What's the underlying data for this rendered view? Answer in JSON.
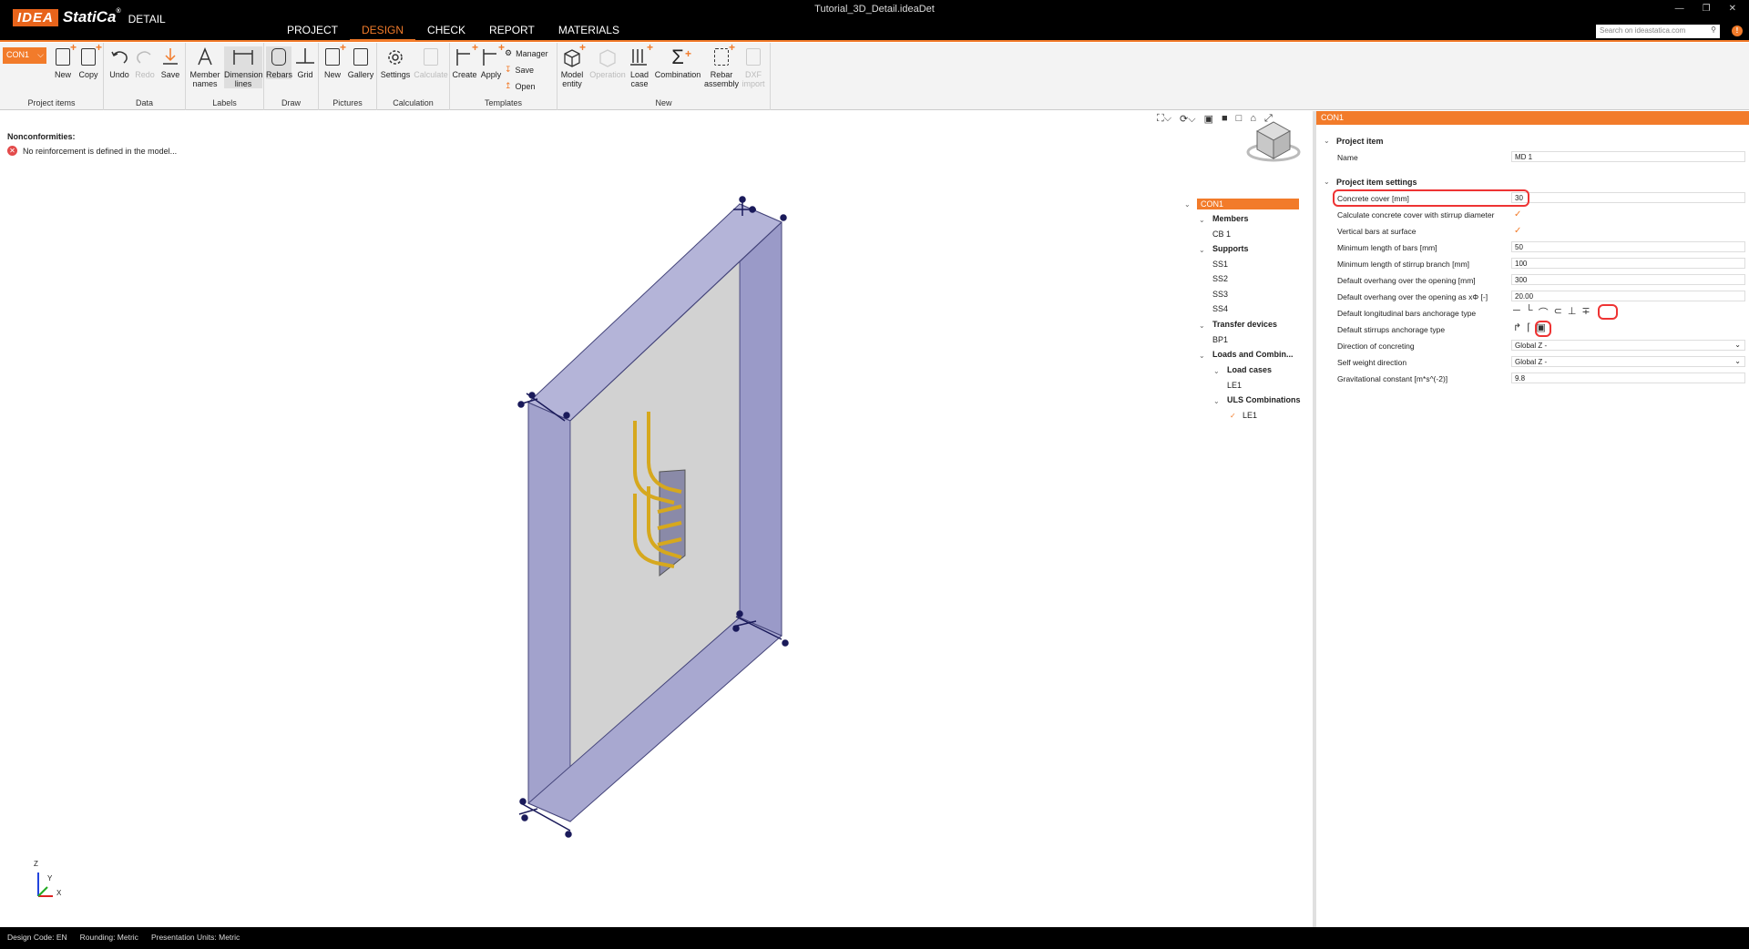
{
  "app": {
    "file_title": "Tutorial_3D_Detail.ideaDet",
    "logo_a": "IDEA",
    "logo_b": "StatiCa",
    "logo_reg": "®",
    "logo_c": "DETAIL"
  },
  "menu": [
    "PROJECT",
    "DESIGN",
    "CHECK",
    "REPORT",
    "MATERIALS"
  ],
  "search": {
    "placeholder": "Search on ideastatica.com"
  },
  "ribbon": {
    "con_select": "CON1",
    "groups": {
      "project_items": "Project items",
      "data": "Data",
      "labels": "Labels",
      "draw": "Draw",
      "pictures": "Pictures",
      "calculation": "Calculation",
      "templates": "Templates",
      "new": "New"
    },
    "buttons": {
      "new": "New",
      "copy": "Copy",
      "undo": "Undo",
      "redo": "Redo",
      "save": "Save",
      "member_names_1": "Member",
      "member_names_2": "names",
      "dimension_lines_1": "Dimension",
      "dimension_lines_2": "lines",
      "rebars": "Rebars",
      "grid": "Grid",
      "pic_new": "New",
      "gallery": "Gallery",
      "settings": "Settings",
      "calculate": "Calculate",
      "create": "Create",
      "apply": "Apply",
      "manager": "Manager",
      "tpl_save": "Save",
      "open": "Open",
      "model_entity_1": "Model",
      "model_entity_2": "entity",
      "operation": "Operation",
      "load_case_1": "Load",
      "load_case_2": "case",
      "combination": "Combination",
      "rebar_assembly_1": "Rebar",
      "rebar_assembly_2": "assembly",
      "dxf_import_1": "DXF",
      "dxf_import_2": "import"
    }
  },
  "nonconformities": {
    "title": "Nonconformities:",
    "message": "No reinforcement is defined in the model..."
  },
  "tree": {
    "root": "CON1",
    "members": "Members",
    "cb1": "CB 1",
    "supports": "Supports",
    "ss1": "SS1",
    "ss2": "SS2",
    "ss3": "SS3",
    "ss4": "SS4",
    "transfer": "Transfer devices",
    "bp1": "BP1",
    "loads": "Loads and Combin...",
    "load_cases": "Load cases",
    "le1": "LE1",
    "uls": "ULS Combinations",
    "le1_uls": "LE1"
  },
  "props": {
    "header": "CON1",
    "sec_item": "Project item",
    "name_label": "Name",
    "name_value": "MD 1",
    "sec_settings": "Project item settings",
    "rows": [
      {
        "label": "Concrete cover [mm]",
        "value": "30"
      },
      {
        "label": "Calculate concrete cover with stirrup diameter",
        "value": "✓"
      },
      {
        "label": "Vertical bars at surface",
        "value": "✓"
      },
      {
        "label": "Minimum length of bars [mm]",
        "value": "50"
      },
      {
        "label": "Minimum length of stirrup branch [mm]",
        "value": "100"
      },
      {
        "label": "Default overhang over the opening [mm]",
        "value": "300"
      },
      {
        "label": "Default overhang over the opening as xΦ [-]",
        "value": "20.00"
      },
      {
        "label": "Default longitudinal bars anchorage type",
        "value": ""
      },
      {
        "label": "Default stirrups anchorage type",
        "value": ""
      },
      {
        "label": "Direction of concreting",
        "value": "Global Z -"
      },
      {
        "label": "Self weight direction",
        "value": "Global Z -"
      },
      {
        "label": "Gravitational constant [m*s^(-2)]",
        "value": "9.8"
      }
    ]
  },
  "axes": {
    "z": "Z",
    "y": "Y",
    "x": "X"
  },
  "status": {
    "code": "Design Code: EN",
    "rounding": "Rounding: Metric",
    "units": "Presentation Units: Metric"
  },
  "colors": {
    "accent": "#f27b2a",
    "highlight": "#e33333",
    "rebar": "#e0b020",
    "wall": "#9a9ac8"
  }
}
